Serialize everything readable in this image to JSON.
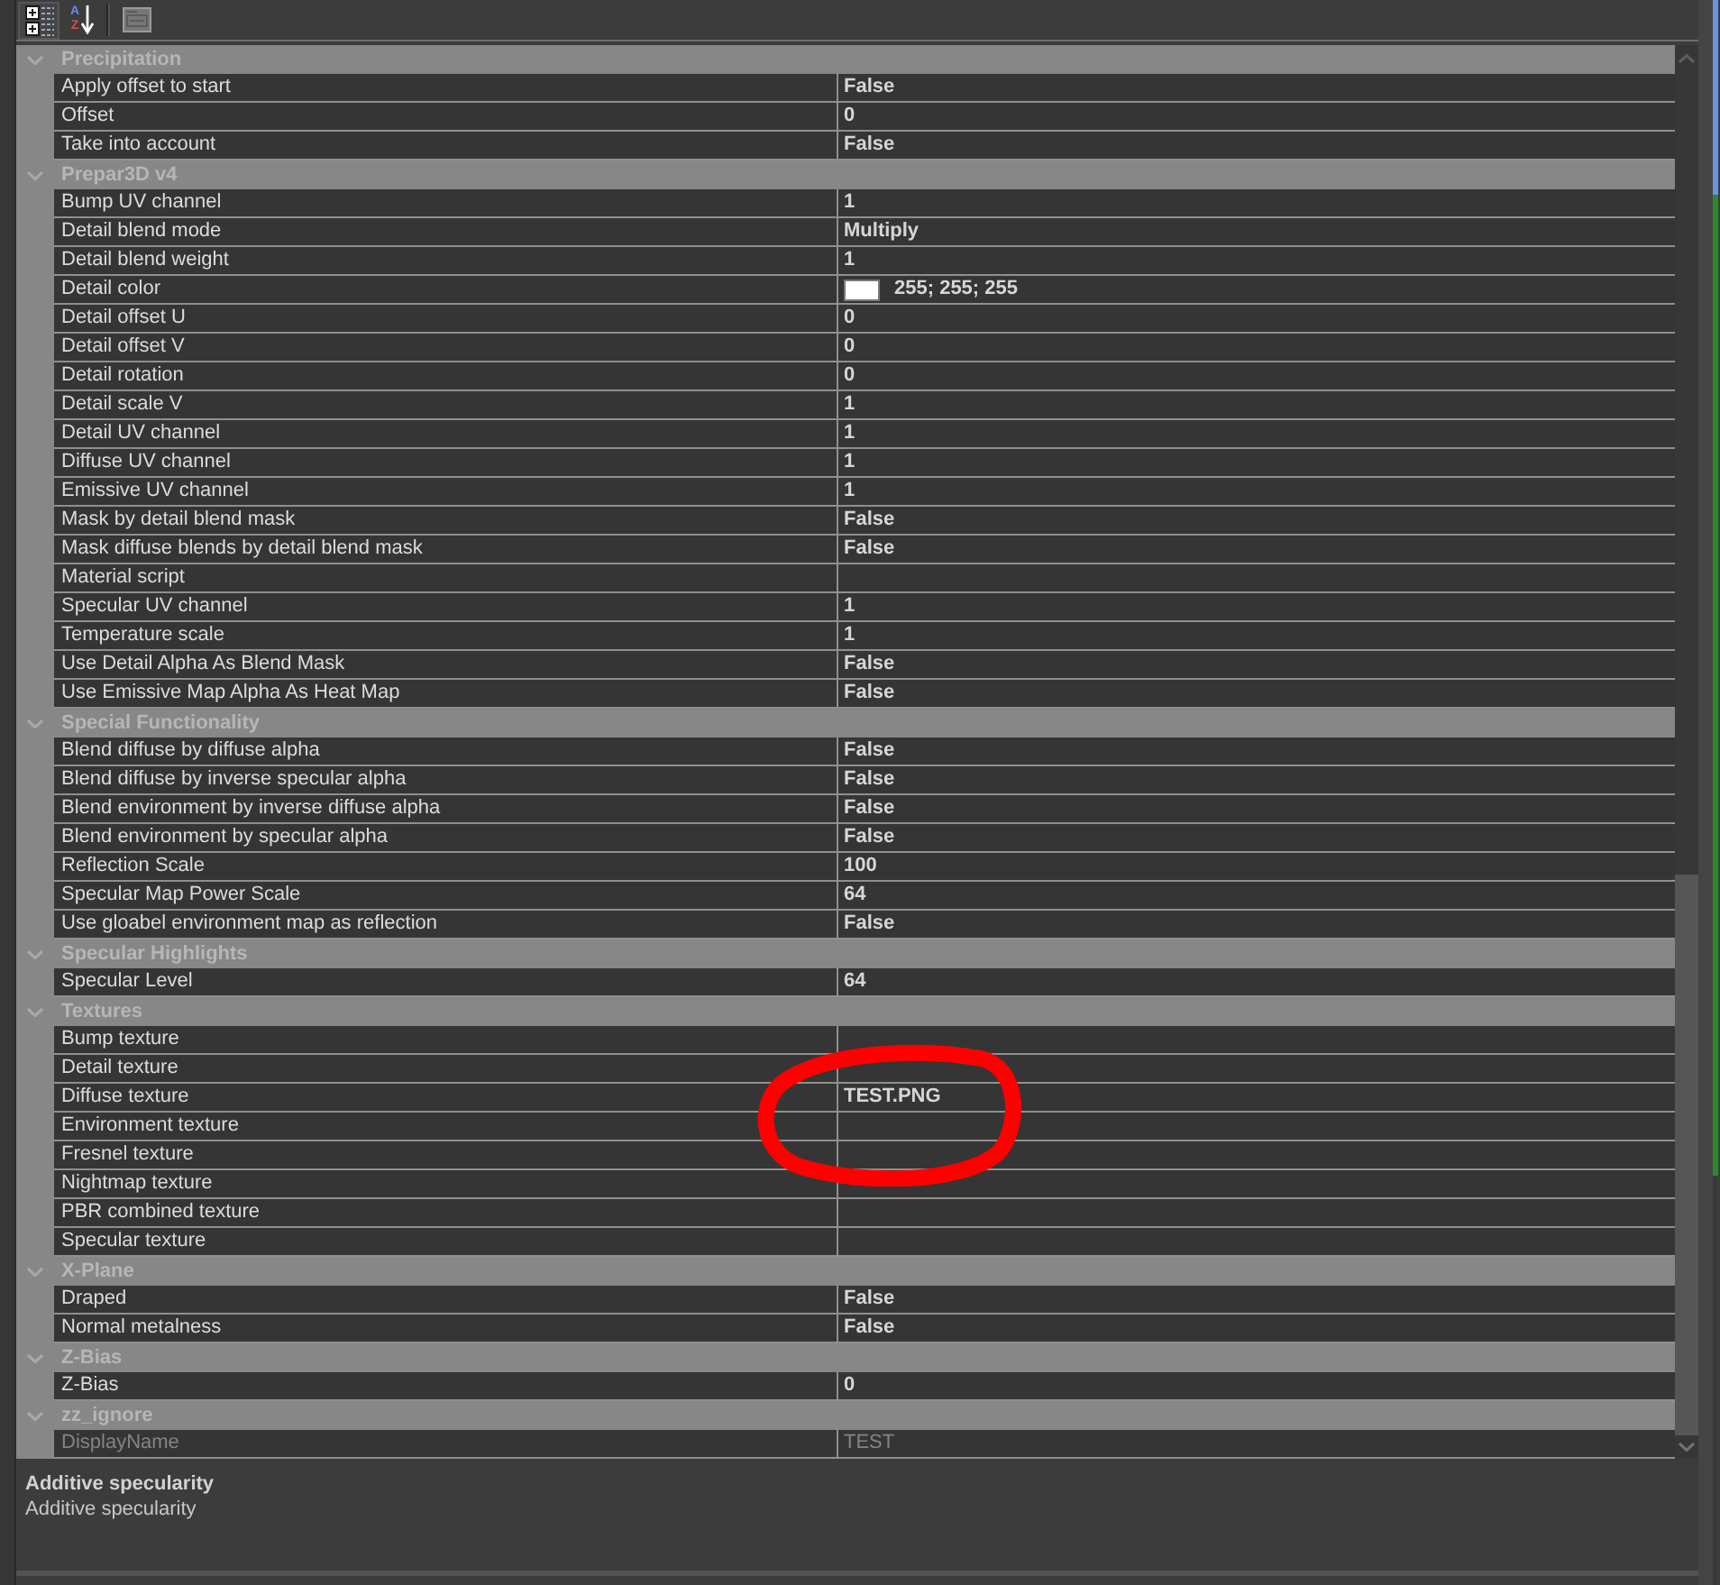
{
  "toolbar": {
    "view_buttons": [
      {
        "kind": "categorized",
        "selected": true
      },
      {
        "kind": "alphabetical",
        "selected": false,
        "letters": [
          "A",
          "Z"
        ]
      }
    ],
    "pages_button": {
      "disabled": true
    }
  },
  "categories": [
    {
      "title": "Precipitation",
      "expanded": true,
      "properties": [
        {
          "name": "Apply offset to start",
          "kind": "text",
          "value": "False",
          "disabled": false,
          "circled": false
        },
        {
          "name": "Offset",
          "kind": "text",
          "value": "0",
          "disabled": false,
          "circled": false
        },
        {
          "name": "Take into account",
          "kind": "text",
          "value": "False",
          "disabled": false,
          "circled": false
        }
      ]
    },
    {
      "title": "Prepar3D v4",
      "expanded": true,
      "properties": [
        {
          "name": "Bump UV channel",
          "kind": "text",
          "value": "1",
          "disabled": false,
          "circled": false
        },
        {
          "name": "Detail blend mode",
          "kind": "text",
          "value": "Multiply",
          "disabled": false,
          "circled": false
        },
        {
          "name": "Detail blend weight",
          "kind": "text",
          "value": "1",
          "disabled": false,
          "circled": false
        },
        {
          "name": "Detail color",
          "kind": "color",
          "color": "#ffffff",
          "value": "255; 255; 255",
          "disabled": false,
          "circled": false
        },
        {
          "name": "Detail offset U",
          "kind": "text",
          "value": "0",
          "disabled": false,
          "circled": false
        },
        {
          "name": "Detail offset V",
          "kind": "text",
          "value": "0",
          "disabled": false,
          "circled": false
        },
        {
          "name": "Detail rotation",
          "kind": "text",
          "value": "0",
          "disabled": false,
          "circled": false
        },
        {
          "name": "Detail scale V",
          "kind": "text",
          "value": "1",
          "disabled": false,
          "circled": false
        },
        {
          "name": "Detail UV channel",
          "kind": "text",
          "value": "1",
          "disabled": false,
          "circled": false
        },
        {
          "name": "Diffuse UV channel",
          "kind": "text",
          "value": "1",
          "disabled": false,
          "circled": false
        },
        {
          "name": "Emissive UV channel",
          "kind": "text",
          "value": "1",
          "disabled": false,
          "circled": false
        },
        {
          "name": "Mask by detail blend mask",
          "kind": "text",
          "value": "False",
          "disabled": false,
          "circled": false
        },
        {
          "name": "Mask diffuse blends by detail blend mask",
          "kind": "text",
          "value": "False",
          "disabled": false,
          "circled": false
        },
        {
          "name": "Material script",
          "kind": "text",
          "disabled": false,
          "circled": false
        },
        {
          "name": "Specular UV channel",
          "kind": "text",
          "value": "1",
          "disabled": false,
          "circled": false
        },
        {
          "name": "Temperature scale",
          "kind": "text",
          "value": "1",
          "disabled": false,
          "circled": false
        },
        {
          "name": "Use Detail Alpha As Blend Mask",
          "kind": "text",
          "value": "False",
          "disabled": false,
          "circled": false
        },
        {
          "name": "Use Emissive Map Alpha As Heat Map",
          "kind": "text",
          "value": "False",
          "disabled": false,
          "circled": false
        }
      ]
    },
    {
      "title": "Special Functionality",
      "expanded": true,
      "properties": [
        {
          "name": "Blend diffuse by diffuse alpha",
          "kind": "text",
          "value": "False",
          "disabled": false,
          "circled": false
        },
        {
          "name": "Blend diffuse by inverse specular alpha",
          "kind": "text",
          "value": "False",
          "disabled": false,
          "circled": false
        },
        {
          "name": "Blend environment by inverse diffuse alpha",
          "kind": "text",
          "value": "False",
          "disabled": false,
          "circled": false
        },
        {
          "name": "Blend environment by specular alpha",
          "kind": "text",
          "value": "False",
          "disabled": false,
          "circled": false
        },
        {
          "name": "Reflection Scale",
          "kind": "text",
          "value": "100",
          "disabled": false,
          "circled": false
        },
        {
          "name": "Specular Map Power Scale",
          "kind": "text",
          "value": "64",
          "disabled": false,
          "circled": false
        },
        {
          "name": "Use gloabel environment map as reflection",
          "kind": "text",
          "value": "False",
          "disabled": false,
          "circled": false
        }
      ]
    },
    {
      "title": "Specular Highlights",
      "expanded": true,
      "properties": [
        {
          "name": "Specular Level",
          "kind": "text",
          "value": "64",
          "disabled": false,
          "circled": false
        }
      ]
    },
    {
      "title": "Textures",
      "expanded": true,
      "properties": [
        {
          "name": "Bump texture",
          "kind": "text",
          "disabled": false,
          "circled": false
        },
        {
          "name": "Detail texture",
          "kind": "text",
          "disabled": false,
          "circled": false
        },
        {
          "name": "Diffuse texture",
          "kind": "text",
          "value": "TEST.PNG",
          "disabled": false,
          "circled": true
        },
        {
          "name": "Environment texture",
          "kind": "text",
          "disabled": false,
          "circled": false
        },
        {
          "name": "Fresnel texture",
          "kind": "text",
          "disabled": false,
          "circled": false
        },
        {
          "name": "Nightmap texture",
          "kind": "text",
          "disabled": false,
          "circled": false
        },
        {
          "name": "PBR combined texture",
          "kind": "text",
          "disabled": false,
          "circled": false
        },
        {
          "name": "Specular texture",
          "kind": "text",
          "disabled": false,
          "circled": false
        }
      ]
    },
    {
      "title": "X-Plane",
      "expanded": true,
      "properties": [
        {
          "name": "Draped",
          "kind": "text",
          "value": "False",
          "disabled": false,
          "circled": false
        },
        {
          "name": "Normal metalness",
          "kind": "text",
          "value": "False",
          "disabled": false,
          "circled": false
        }
      ]
    },
    {
      "title": "Z-Bias",
      "expanded": true,
      "properties": [
        {
          "name": "Z-Bias",
          "kind": "text",
          "value": "0",
          "disabled": false,
          "circled": false
        }
      ]
    },
    {
      "title": "zz_ignore",
      "expanded": true,
      "properties": [
        {
          "name": "DisplayName",
          "kind": "text",
          "value": "TEST",
          "disabled": true,
          "circled": false
        }
      ]
    }
  ],
  "description": {
    "title": "Additive specularity",
    "text": "Additive specularity"
  }
}
